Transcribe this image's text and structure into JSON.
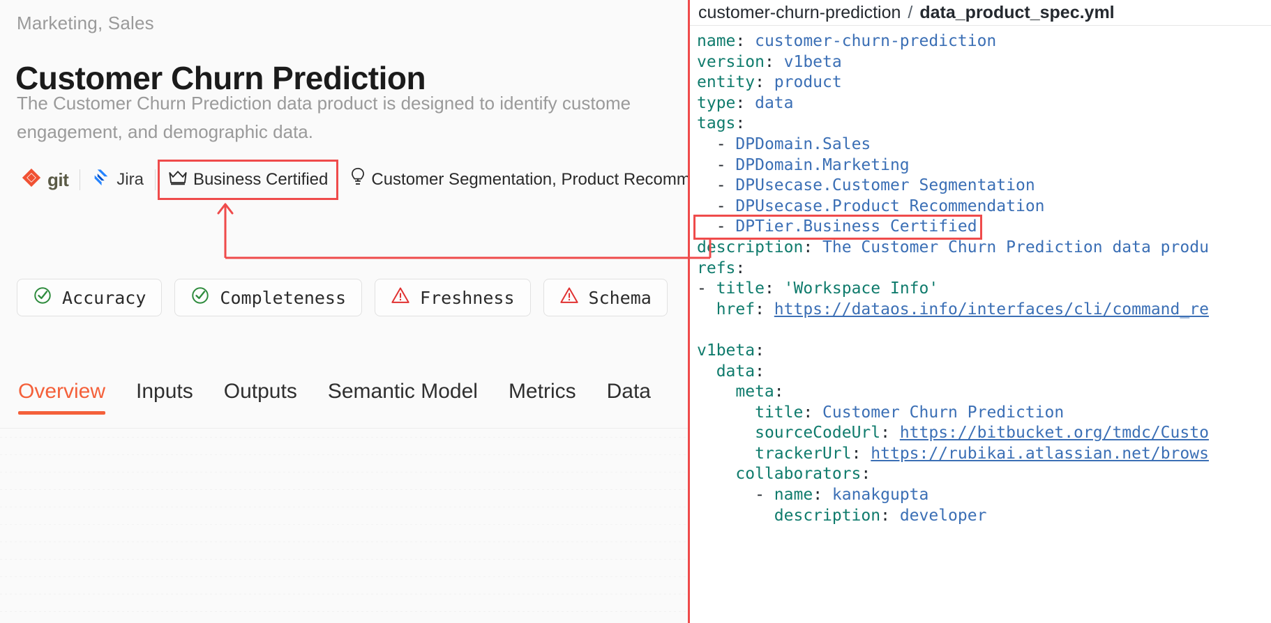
{
  "left": {
    "domains": "Marketing, Sales",
    "title": "Customer Churn Prediction",
    "description": "The Customer Churn Prediction data product is designed to identify custome engagement, and demographic data.",
    "meta_chips": [
      {
        "icon": "git-icon",
        "label": "git"
      },
      {
        "icon": "jira-icon",
        "label": "Jira"
      },
      {
        "icon": "crown-icon",
        "label": "Business Certified",
        "highlighted": true
      },
      {
        "icon": "bulb-icon",
        "label": "Customer Segmentation, Product Recommen"
      }
    ],
    "quality_badges": [
      {
        "icon": "check-circle-icon",
        "label": "Accuracy",
        "status": "pass"
      },
      {
        "icon": "check-circle-icon",
        "label": "Completeness",
        "status": "pass"
      },
      {
        "icon": "warning-triangle-icon",
        "label": "Freshness",
        "status": "warn"
      },
      {
        "icon": "warning-triangle-icon",
        "label": "Schema",
        "status": "warn"
      }
    ],
    "tabs": [
      {
        "label": "Overview",
        "active": true
      },
      {
        "label": "Inputs",
        "active": false
      },
      {
        "label": "Outputs",
        "active": false
      },
      {
        "label": "Semantic Model",
        "active": false
      },
      {
        "label": "Metrics",
        "active": false
      },
      {
        "label": "Data",
        "active": false
      }
    ]
  },
  "right": {
    "breadcrumb_repo": "customer-churn-prediction",
    "breadcrumb_separator": "/",
    "breadcrumb_file": "data_product_spec.yml",
    "yaml_lines": [
      {
        "indent": 0,
        "key": "name",
        "value": "customer-churn-prediction",
        "kind": "pair"
      },
      {
        "indent": 0,
        "key": "version",
        "value": "v1beta",
        "kind": "pair"
      },
      {
        "indent": 0,
        "key": "entity",
        "value": "product",
        "kind": "pair"
      },
      {
        "indent": 0,
        "key": "type",
        "value": "data",
        "kind": "pair"
      },
      {
        "indent": 0,
        "key": "tags",
        "value": "",
        "kind": "key"
      },
      {
        "indent": 1,
        "key": "",
        "value": "DPDomain.Sales",
        "kind": "item"
      },
      {
        "indent": 1,
        "key": "",
        "value": "DPDomain.Marketing",
        "kind": "item"
      },
      {
        "indent": 1,
        "key": "",
        "value": "DPUsecase.Customer Segmentation",
        "kind": "item"
      },
      {
        "indent": 1,
        "key": "",
        "value": "DPUsecase.Product Recommendation",
        "kind": "item"
      },
      {
        "indent": 1,
        "key": "",
        "value": "DPTier.Business Certified",
        "kind": "item",
        "highlighted": true
      },
      {
        "indent": 0,
        "key": "description",
        "value": "The Customer Churn Prediction data produ",
        "kind": "pair"
      },
      {
        "indent": 0,
        "key": "refs",
        "value": "",
        "kind": "key"
      },
      {
        "indent": 0,
        "key": "title",
        "value": "'Workspace Info'",
        "kind": "item-pair",
        "string": true
      },
      {
        "indent": 1,
        "key": "href",
        "value": "https://dataos.info/interfaces/cli/command_re",
        "kind": "pair",
        "link": true
      },
      {
        "indent": 0,
        "key": "",
        "value": "",
        "kind": "blank"
      },
      {
        "indent": 0,
        "key": "v1beta",
        "value": "",
        "kind": "key"
      },
      {
        "indent": 1,
        "key": "data",
        "value": "",
        "kind": "key"
      },
      {
        "indent": 2,
        "key": "meta",
        "value": "",
        "kind": "key"
      },
      {
        "indent": 3,
        "key": "title",
        "value": "Customer Churn Prediction",
        "kind": "pair"
      },
      {
        "indent": 3,
        "key": "sourceCodeUrl",
        "value": "https://bitbucket.org/tmdc/Custo",
        "kind": "pair",
        "link": true
      },
      {
        "indent": 3,
        "key": "trackerUrl",
        "value": "https://rubikai.atlassian.net/brows",
        "kind": "pair",
        "link": true
      },
      {
        "indent": 2,
        "key": "collaborators",
        "value": "",
        "kind": "key"
      },
      {
        "indent": 3,
        "key": "name",
        "value": "kanakgupta",
        "kind": "item-pair2"
      },
      {
        "indent": 4,
        "key": "description",
        "value": "developer",
        "kind": "pair"
      }
    ]
  },
  "annotation": {
    "color": "#ef4b4b",
    "description": "red callout connecting the Business Certified badge to the DPTier.Business Certified YAML tag"
  },
  "colors": {
    "accent": "#f4603a",
    "annotation_red": "#ef4b4b",
    "yaml_key": "#0f7b6c",
    "yaml_value": "#3b6fb5",
    "pass_green": "#2e8b3d",
    "warn_red": "#e03131",
    "muted_text": "#9a9a9a"
  }
}
